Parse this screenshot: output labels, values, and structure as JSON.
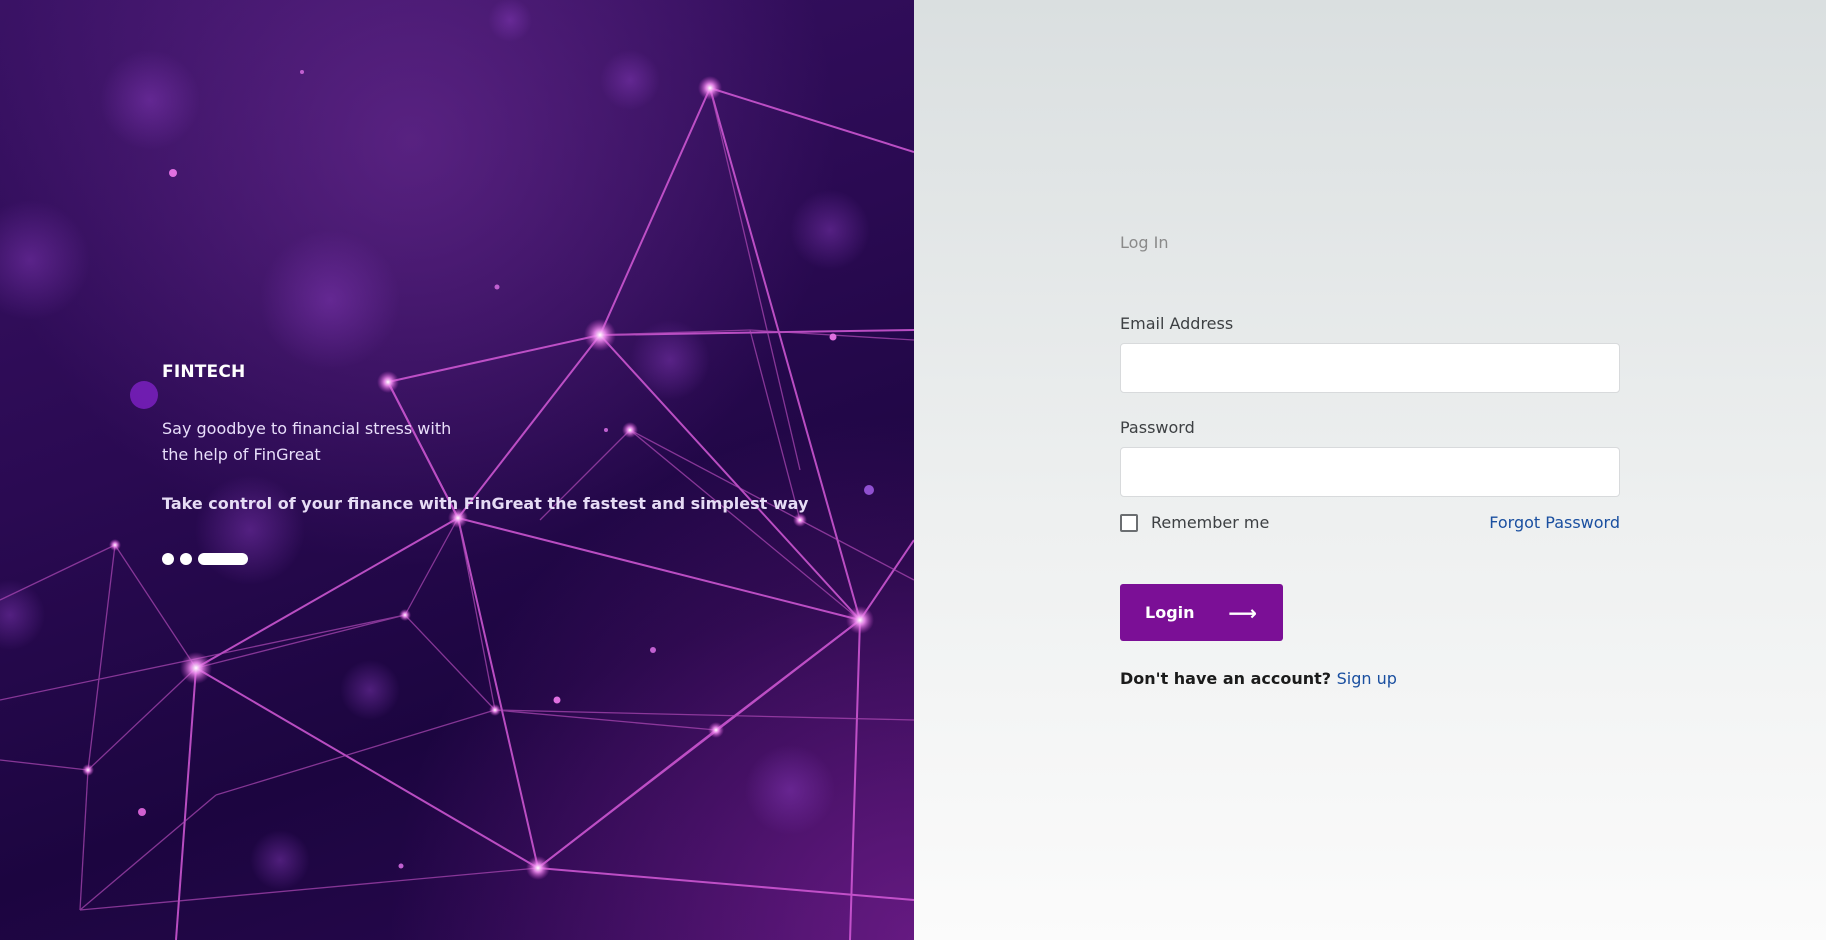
{
  "hero": {
    "brand": "FINTECH",
    "tagline": "Say goodbye to financial stress with the help of FinGreat",
    "subtagline": "Take control of your finance with FinGreat the fastest and simplest way",
    "slides": [
      "slide-1",
      "slide-2",
      "slide-3"
    ],
    "active_slide_index": 2
  },
  "auth": {
    "title": "Log In",
    "email_label": "Email Address",
    "email_value": "",
    "password_label": "Password",
    "password_value": "",
    "remember_label": "Remember me",
    "remember_checked": false,
    "forgot_label": "Forgot Password",
    "login_label": "Login",
    "login_icon": "arrow-right-icon",
    "signup_prompt": "Don't have an account?",
    "signup_label": "Sign up"
  },
  "colors": {
    "primary": "#7b0f96",
    "link": "#1a4fa0",
    "hero_bg": "#2a0a52",
    "auth_bg": "#eef0f0"
  }
}
